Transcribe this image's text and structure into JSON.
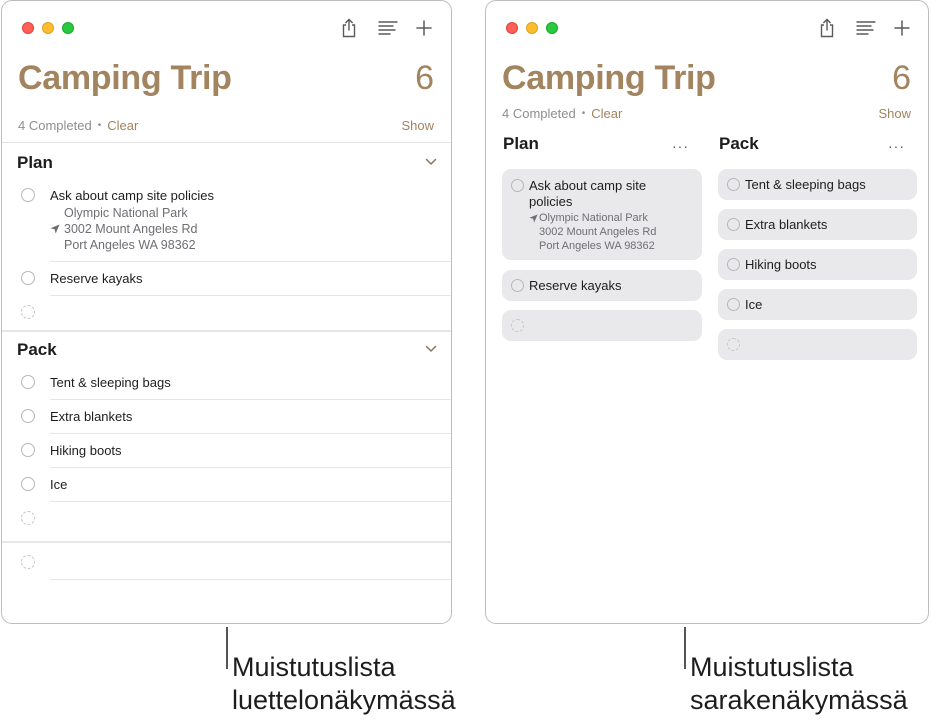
{
  "list": {
    "title": "Camping Trip",
    "count": "6",
    "completed": "4 Completed",
    "separator": "•",
    "clear": "Clear",
    "show": "Show"
  },
  "sections": {
    "plan": {
      "name": "Plan",
      "task1": "Ask about camp site policies",
      "task1_line1": "Olympic National Park",
      "task1_line2": "3002 Mount Angeles Rd",
      "task1_line3": "Port Angeles WA 98362",
      "task2": "Reserve kayaks"
    },
    "pack": {
      "name": "Pack",
      "task1": "Tent & sleeping bags",
      "task2": "Extra blankets",
      "task3": "Hiking boots",
      "task4": "Ice"
    }
  },
  "columns": {
    "plan_task1_line1": "Ask about camp site",
    "plan_task1_line2": "policies",
    "more": "···"
  },
  "captions": {
    "left_line1": "Muistutuslista",
    "left_line2": "luettelonäkymässä",
    "right_line1": "Muistutuslista",
    "right_line2": "sarakenäkymässä"
  },
  "colors": {
    "accent": "#a2845e",
    "close": "#fe5f57",
    "minimize": "#febc2e",
    "zoom": "#28c840",
    "card": "#e9e9ec"
  },
  "icons": [
    "share-icon",
    "view-options-icon",
    "add-icon",
    "chevron-down-icon",
    "location-arrow-icon"
  ]
}
